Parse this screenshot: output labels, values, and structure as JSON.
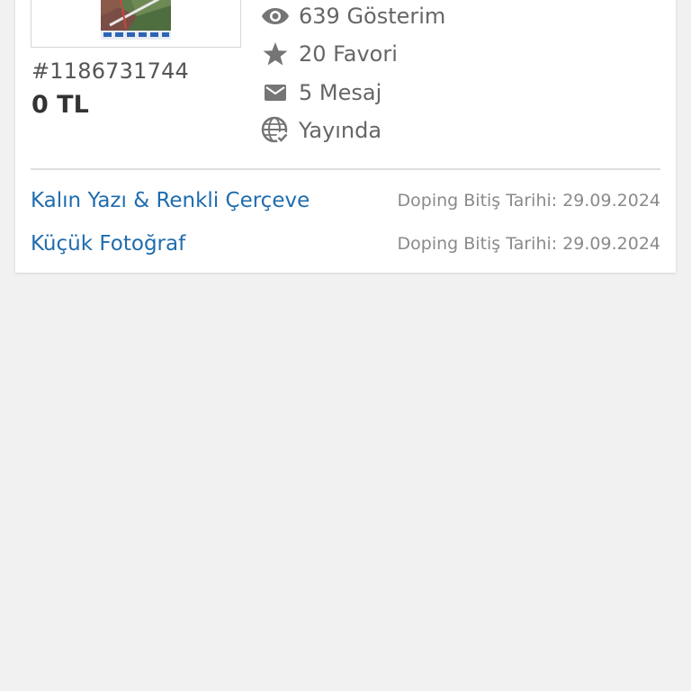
{
  "listing": {
    "id": "#1186731744",
    "price": "0 TL"
  },
  "stats": [
    {
      "icon": "eye-icon",
      "label": "639 Gösterim"
    },
    {
      "icon": "star-icon",
      "label": "20 Favori"
    },
    {
      "icon": "mail-icon",
      "label": "5 Mesaj"
    },
    {
      "icon": "globe-check-icon",
      "label": "Yayında"
    }
  ],
  "dopings": [
    {
      "name": "Kalın Yazı & Renkli Çerçeve",
      "date": "Doping Bitiş Tarihi: 29.09.2024"
    },
    {
      "name": "Küçük Fotoğraf",
      "date": "Doping Bitiş Tarihi: 29.09.2024"
    }
  ],
  "colors": {
    "link": "#1f6cae",
    "icon": "#757575",
    "background": "#f1f1f1"
  }
}
